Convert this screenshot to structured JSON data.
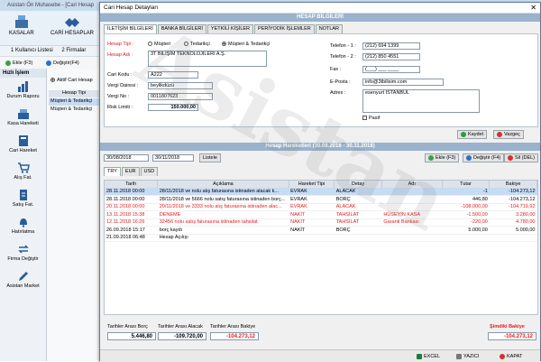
{
  "app": {
    "title": "Asistan Ön Muhasebe - [Cari Hesap",
    "ribbon": {
      "kasalar": "KASALAR",
      "cari_hesaplar": "CARİ HESAPLAR"
    },
    "subbar": {
      "item1": "1 Kullanıcı Listesi",
      "item2": "2 Firmalar"
    },
    "toolbar2": {
      "ekle": "Ekle (F3)",
      "degistir": "Değiştir(F4)"
    },
    "sidebar": {
      "title": "Hızlı İşlem",
      "items": [
        "Durum Raporu",
        "Kasa Hareketi",
        "Cari Hareket",
        "Alış Fat.",
        "Satış Fat.",
        "Hatırlatma",
        "Firma Değiştir",
        "Asistan Market"
      ]
    },
    "leftlist": {
      "radio": "Aktif Cari Hesap",
      "header": "Hesap Tipi",
      "rows": [
        "Müşteri & Tedarikçi",
        "Müşteri & Tedarikçi"
      ]
    }
  },
  "dialog": {
    "title": "Cari Hesap Detayları",
    "close": "✕",
    "section_title": "HESAP BİLGİLERİ",
    "tabs": [
      "İLETİŞİM BİLGİLERİ",
      "BANKA BİLGİLERİ",
      "YETKİLİ KİŞİLER",
      "PERİYODİK İŞLEMLER",
      "NOTLAR"
    ],
    "form": {
      "hesap_tipi_label": "Hesap Tipi :",
      "hesap_tipi_options": [
        "Müşteri",
        "Tedarikçi",
        "Müşteri & Tedarikçi"
      ],
      "hesap_adi_label": "Hesap Adı :",
      "hesap_adi_value": "3T BİLİŞİM TEKNOLOJİLERİ A.Ş.",
      "cari_kodu_label": "Cari Kodu :",
      "cari_kodu_value": "A222",
      "vergi_dairesi_label": "Vergi Dairesi :",
      "vergi_dairesi_value": "beylikdüzü",
      "vergi_no_label": "Vergi No :",
      "vergi_no_value": "0011807623",
      "risk_limiti_label": "Risk Limiti :",
      "risk_limiti_value": "150.000,00",
      "telefon1_label": "Telefon - 1 :",
      "telefon1_value": "(212) 694 1399",
      "telefon2_label": "Telefon - 2 :",
      "telefon2_value": "(212) 850 4551",
      "fax_label": "Fax :",
      "fax_value": "(___) ___ ____",
      "eposta_label": "E-Posta :",
      "eposta_value": "info@3tbilisim.com",
      "adres_label": "Adres :",
      "adres_value": "esenyurt İSTANBUL",
      "pasif_label": "Pasif"
    },
    "buttons": {
      "kaydet": "Kaydet",
      "vazgec": "Vazgeç"
    },
    "movements": {
      "title": "Hesap Hareketleri (30.08.2018 - 30.11.2018)",
      "date_from": "30/08/2018",
      "date_to": "30/11/2018",
      "listele": "Listele",
      "ekle": "Ekle (F3)",
      "degistir": "Değiştir (F4)",
      "sil": "Sil (DEL)",
      "currency_tabs": [
        "TRY",
        "EUR",
        "USD"
      ],
      "columns": [
        "Tarih",
        "Açıklama",
        "Hareket Tipi",
        "Detay",
        "Adı",
        "Tutar",
        "Bakiye"
      ],
      "rows": [
        {
          "tarih": "28.11.2018 00:00",
          "aciklama": "28/11/2018 ve nolu alış faturasına istinaden alacak k...",
          "tip": "EVRAK",
          "detay": "ALACAK",
          "adi": "",
          "tutar": "-1",
          "bakiye": "-104.273,12",
          "style": "sel"
        },
        {
          "tarih": "28.11.2018 00:00",
          "aciklama": "28/11/2018 ve 5666 nolu satış faturasına istinaden borç...",
          "tip": "EVRAK",
          "detay": "BORÇ",
          "adi": "",
          "tutar": "446,80",
          "bakiye": "-104.273,12",
          "style": ""
        },
        {
          "tarih": "20.11.2018 00:00",
          "aciklama": "20/11/2018 ve 3333 nolu alış faturasına istinaden alac...",
          "tip": "EVRAK",
          "detay": "ALACAK",
          "adi": "",
          "tutar": "-108.000,00",
          "bakiye": "-104.719,92",
          "style": "red"
        },
        {
          "tarih": "13.11.2018 15:38",
          "aciklama": "DENEME",
          "tip": "NAKİT",
          "detay": "TAHSİLAT",
          "adi": "HÜSEYİN KASA",
          "tutar": "-1.500,00",
          "bakiye": "3.280,00",
          "style": "red"
        },
        {
          "tarih": "12.11.2018 16:26",
          "aciklama": "32456 nolu satış faturasına istinaden tahsilat",
          "tip": "NAKİT",
          "detay": "TAHSİLAT",
          "adi": "Garanti Bankası",
          "tutar": "-220,00",
          "bakiye": "4.780,00",
          "style": "red"
        },
        {
          "tarih": "26.09.2018 15:17",
          "aciklama": "borç kaydı",
          "tip": "NAKİT",
          "detay": "BORÇ",
          "adi": "",
          "tutar": "5.000,00",
          "bakiye": "5.000,00",
          "style": ""
        },
        {
          "tarih": "21.09.2018 06:48",
          "aciklama": "Hesap Açılışı",
          "tip": "",
          "detay": "",
          "adi": "",
          "tutar": "",
          "bakiye": "",
          "style": ""
        }
      ],
      "footer": {
        "borc_label": "Tarihler Arası Borç",
        "borc_value": "5.446,80",
        "alacak_label": "Tarihler Arası Alacak",
        "alacak_value": "-109.720,00",
        "bakiye_label": "Tarihler Arası Bakiye",
        "bakiye_value": "-104.273,12",
        "simdiki_label": "Şimdiki Bakiye",
        "simdiki_value": "-104.273,12"
      }
    },
    "bottom_buttons": {
      "excel": "EXCEL",
      "yazici": "YAZICI",
      "kapat": "KAPAT"
    }
  },
  "watermark": "Asistan",
  "colors": {
    "accent": "#9ab2cc",
    "red": "#e02020",
    "selected_row": "#c7dbf3"
  }
}
